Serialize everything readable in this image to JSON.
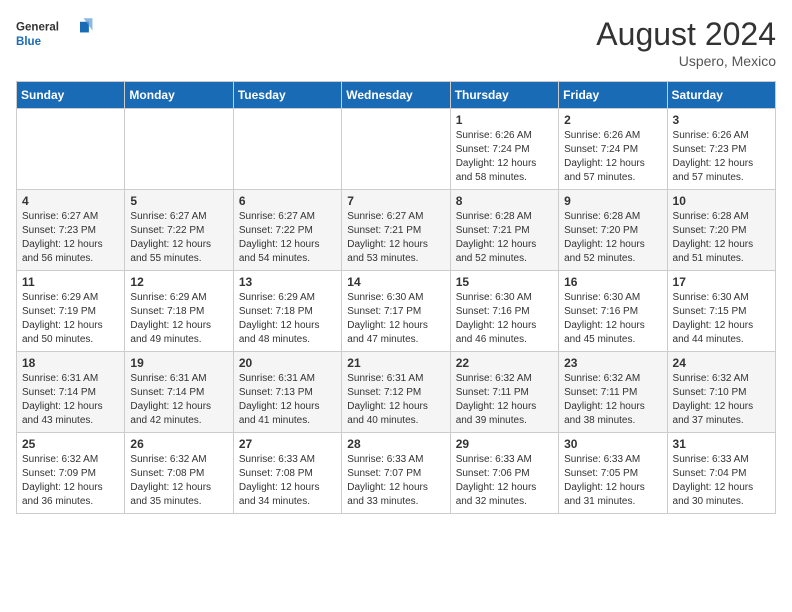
{
  "header": {
    "logo_general": "General",
    "logo_blue": "Blue",
    "month_year": "August 2024",
    "location": "Uspero, Mexico"
  },
  "calendar": {
    "days_of_week": [
      "Sunday",
      "Monday",
      "Tuesday",
      "Wednesday",
      "Thursday",
      "Friday",
      "Saturday"
    ],
    "weeks": [
      [
        {
          "day": "",
          "sunrise": "",
          "sunset": "",
          "daylight": ""
        },
        {
          "day": "",
          "sunrise": "",
          "sunset": "",
          "daylight": ""
        },
        {
          "day": "",
          "sunrise": "",
          "sunset": "",
          "daylight": ""
        },
        {
          "day": "",
          "sunrise": "",
          "sunset": "",
          "daylight": ""
        },
        {
          "day": "1",
          "sunrise": "Sunrise: 6:26 AM",
          "sunset": "Sunset: 7:24 PM",
          "daylight": "Daylight: 12 hours and 58 minutes."
        },
        {
          "day": "2",
          "sunrise": "Sunrise: 6:26 AM",
          "sunset": "Sunset: 7:24 PM",
          "daylight": "Daylight: 12 hours and 57 minutes."
        },
        {
          "day": "3",
          "sunrise": "Sunrise: 6:26 AM",
          "sunset": "Sunset: 7:23 PM",
          "daylight": "Daylight: 12 hours and 57 minutes."
        }
      ],
      [
        {
          "day": "4",
          "sunrise": "Sunrise: 6:27 AM",
          "sunset": "Sunset: 7:23 PM",
          "daylight": "Daylight: 12 hours and 56 minutes."
        },
        {
          "day": "5",
          "sunrise": "Sunrise: 6:27 AM",
          "sunset": "Sunset: 7:22 PM",
          "daylight": "Daylight: 12 hours and 55 minutes."
        },
        {
          "day": "6",
          "sunrise": "Sunrise: 6:27 AM",
          "sunset": "Sunset: 7:22 PM",
          "daylight": "Daylight: 12 hours and 54 minutes."
        },
        {
          "day": "7",
          "sunrise": "Sunrise: 6:27 AM",
          "sunset": "Sunset: 7:21 PM",
          "daylight": "Daylight: 12 hours and 53 minutes."
        },
        {
          "day": "8",
          "sunrise": "Sunrise: 6:28 AM",
          "sunset": "Sunset: 7:21 PM",
          "daylight": "Daylight: 12 hours and 52 minutes."
        },
        {
          "day": "9",
          "sunrise": "Sunrise: 6:28 AM",
          "sunset": "Sunset: 7:20 PM",
          "daylight": "Daylight: 12 hours and 52 minutes."
        },
        {
          "day": "10",
          "sunrise": "Sunrise: 6:28 AM",
          "sunset": "Sunset: 7:20 PM",
          "daylight": "Daylight: 12 hours and 51 minutes."
        }
      ],
      [
        {
          "day": "11",
          "sunrise": "Sunrise: 6:29 AM",
          "sunset": "Sunset: 7:19 PM",
          "daylight": "Daylight: 12 hours and 50 minutes."
        },
        {
          "day": "12",
          "sunrise": "Sunrise: 6:29 AM",
          "sunset": "Sunset: 7:18 PM",
          "daylight": "Daylight: 12 hours and 49 minutes."
        },
        {
          "day": "13",
          "sunrise": "Sunrise: 6:29 AM",
          "sunset": "Sunset: 7:18 PM",
          "daylight": "Daylight: 12 hours and 48 minutes."
        },
        {
          "day": "14",
          "sunrise": "Sunrise: 6:30 AM",
          "sunset": "Sunset: 7:17 PM",
          "daylight": "Daylight: 12 hours and 47 minutes."
        },
        {
          "day": "15",
          "sunrise": "Sunrise: 6:30 AM",
          "sunset": "Sunset: 7:16 PM",
          "daylight": "Daylight: 12 hours and 46 minutes."
        },
        {
          "day": "16",
          "sunrise": "Sunrise: 6:30 AM",
          "sunset": "Sunset: 7:16 PM",
          "daylight": "Daylight: 12 hours and 45 minutes."
        },
        {
          "day": "17",
          "sunrise": "Sunrise: 6:30 AM",
          "sunset": "Sunset: 7:15 PM",
          "daylight": "Daylight: 12 hours and 44 minutes."
        }
      ],
      [
        {
          "day": "18",
          "sunrise": "Sunrise: 6:31 AM",
          "sunset": "Sunset: 7:14 PM",
          "daylight": "Daylight: 12 hours and 43 minutes."
        },
        {
          "day": "19",
          "sunrise": "Sunrise: 6:31 AM",
          "sunset": "Sunset: 7:14 PM",
          "daylight": "Daylight: 12 hours and 42 minutes."
        },
        {
          "day": "20",
          "sunrise": "Sunrise: 6:31 AM",
          "sunset": "Sunset: 7:13 PM",
          "daylight": "Daylight: 12 hours and 41 minutes."
        },
        {
          "day": "21",
          "sunrise": "Sunrise: 6:31 AM",
          "sunset": "Sunset: 7:12 PM",
          "daylight": "Daylight: 12 hours and 40 minutes."
        },
        {
          "day": "22",
          "sunrise": "Sunrise: 6:32 AM",
          "sunset": "Sunset: 7:11 PM",
          "daylight": "Daylight: 12 hours and 39 minutes."
        },
        {
          "day": "23",
          "sunrise": "Sunrise: 6:32 AM",
          "sunset": "Sunset: 7:11 PM",
          "daylight": "Daylight: 12 hours and 38 minutes."
        },
        {
          "day": "24",
          "sunrise": "Sunrise: 6:32 AM",
          "sunset": "Sunset: 7:10 PM",
          "daylight": "Daylight: 12 hours and 37 minutes."
        }
      ],
      [
        {
          "day": "25",
          "sunrise": "Sunrise: 6:32 AM",
          "sunset": "Sunset: 7:09 PM",
          "daylight": "Daylight: 12 hours and 36 minutes."
        },
        {
          "day": "26",
          "sunrise": "Sunrise: 6:32 AM",
          "sunset": "Sunset: 7:08 PM",
          "daylight": "Daylight: 12 hours and 35 minutes."
        },
        {
          "day": "27",
          "sunrise": "Sunrise: 6:33 AM",
          "sunset": "Sunset: 7:08 PM",
          "daylight": "Daylight: 12 hours and 34 minutes."
        },
        {
          "day": "28",
          "sunrise": "Sunrise: 6:33 AM",
          "sunset": "Sunset: 7:07 PM",
          "daylight": "Daylight: 12 hours and 33 minutes."
        },
        {
          "day": "29",
          "sunrise": "Sunrise: 6:33 AM",
          "sunset": "Sunset: 7:06 PM",
          "daylight": "Daylight: 12 hours and 32 minutes."
        },
        {
          "day": "30",
          "sunrise": "Sunrise: 6:33 AM",
          "sunset": "Sunset: 7:05 PM",
          "daylight": "Daylight: 12 hours and 31 minutes."
        },
        {
          "day": "31",
          "sunrise": "Sunrise: 6:33 AM",
          "sunset": "Sunset: 7:04 PM",
          "daylight": "Daylight: 12 hours and 30 minutes."
        }
      ]
    ]
  }
}
